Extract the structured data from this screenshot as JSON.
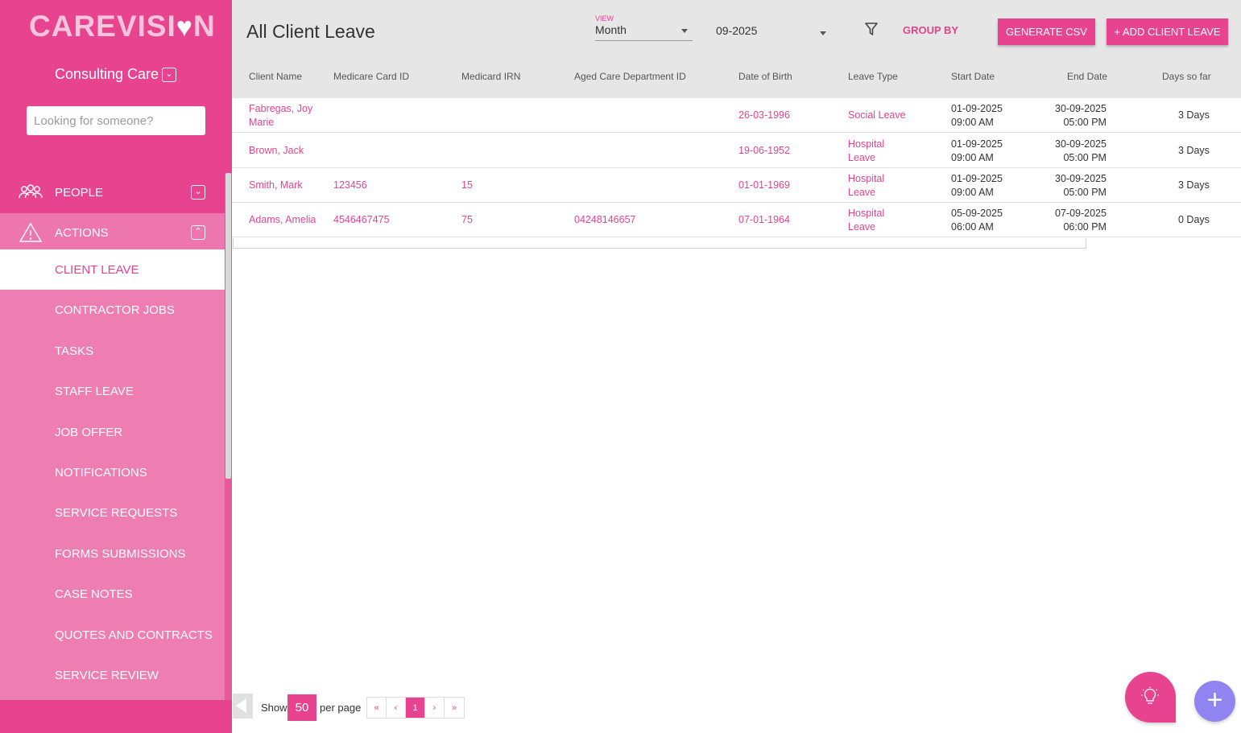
{
  "brand": {
    "logo_before": "CAREVISI",
    "logo_after": "N",
    "logo_heart": "♥",
    "accent": "#e8438f",
    "fab_color": "#8f84f0"
  },
  "sidebar": {
    "organisation": "Consulting Care",
    "search_placeholder": "Looking for someone?",
    "sections": [
      {
        "label": "PEOPLE",
        "icon": "people-icon",
        "expanded": false
      },
      {
        "label": "ACTIONS",
        "icon": "warning-icon",
        "expanded": true
      }
    ],
    "action_items": [
      {
        "label": "CLIENT LEAVE",
        "active": true
      },
      {
        "label": "CONTRACTOR JOBS"
      },
      {
        "label": "TASKS"
      },
      {
        "label": "STAFF LEAVE"
      },
      {
        "label": "JOB OFFER"
      },
      {
        "label": "NOTIFICATIONS"
      },
      {
        "label": "SERVICE REQUESTS"
      },
      {
        "label": "FORMS SUBMISSIONS"
      },
      {
        "label": "CASE NOTES"
      },
      {
        "label": "QUOTES AND CONTRACTS"
      },
      {
        "label": "SERVICE REVIEW"
      }
    ]
  },
  "header": {
    "title": "All Client Leave",
    "view_label": "VIEW",
    "view_value": "Month",
    "date_value": "09-2025",
    "group_by_label": "GROUP BY",
    "generate_csv_label": "GENERATE CSV",
    "add_leave_label": "+ ADD CLIENT LEAVE"
  },
  "table": {
    "columns": [
      "Client Name",
      "Medicare Card ID",
      "Medicard IRN",
      "Aged Care Department ID",
      "Date of Birth",
      "Leave Type",
      "Start Date",
      "End Date",
      "Days so far"
    ],
    "rows": [
      {
        "client_name": "Fabregas, Joy Marie",
        "medicare_id": "",
        "medicare_irn": "",
        "aged_care_id": "",
        "dob": "26-03-1996",
        "leave_type": "Social Leave",
        "start_date": "01-09-2025",
        "start_time": "09:00 AM",
        "end_date": "30-09-2025",
        "end_time": "05:00 PM",
        "days": "3 Days"
      },
      {
        "client_name": "Brown, Jack",
        "medicare_id": "",
        "medicare_irn": "",
        "aged_care_id": "",
        "dob": "19-06-1952",
        "leave_type": "Hospital Leave",
        "start_date": "01-09-2025",
        "start_time": "09:00 AM",
        "end_date": "30-09-2025",
        "end_time": "05:00 PM",
        "days": "3 Days"
      },
      {
        "client_name": "Smith, Mark",
        "medicare_id": "123456",
        "medicare_irn": "15",
        "aged_care_id": "",
        "dob": "01-01-1969",
        "leave_type": "Hospital Leave",
        "start_date": "01-09-2025",
        "start_time": "09:00 AM",
        "end_date": "30-09-2025",
        "end_time": "05:00 PM",
        "days": "3 Days"
      },
      {
        "client_name": "Adams, Amelia",
        "medicare_id": "4546467475",
        "medicare_irn": "75",
        "aged_care_id": "04248146657",
        "dob": "07-01-1964",
        "leave_type": "Hospital Leave",
        "start_date": "05-09-2025",
        "start_time": "06:00 AM",
        "end_date": "07-09-2025",
        "end_time": "06:00 PM",
        "days": "0 Days"
      }
    ]
  },
  "footer": {
    "show_label": "Show",
    "per_page_value": "50",
    "per_page_label": "per page",
    "pager": {
      "first": "«",
      "prev": "‹",
      "current": "1",
      "next": "›",
      "last": "»"
    }
  },
  "fab": {
    "add_symbol": "+",
    "help_icon": "lightbulb-icon"
  }
}
